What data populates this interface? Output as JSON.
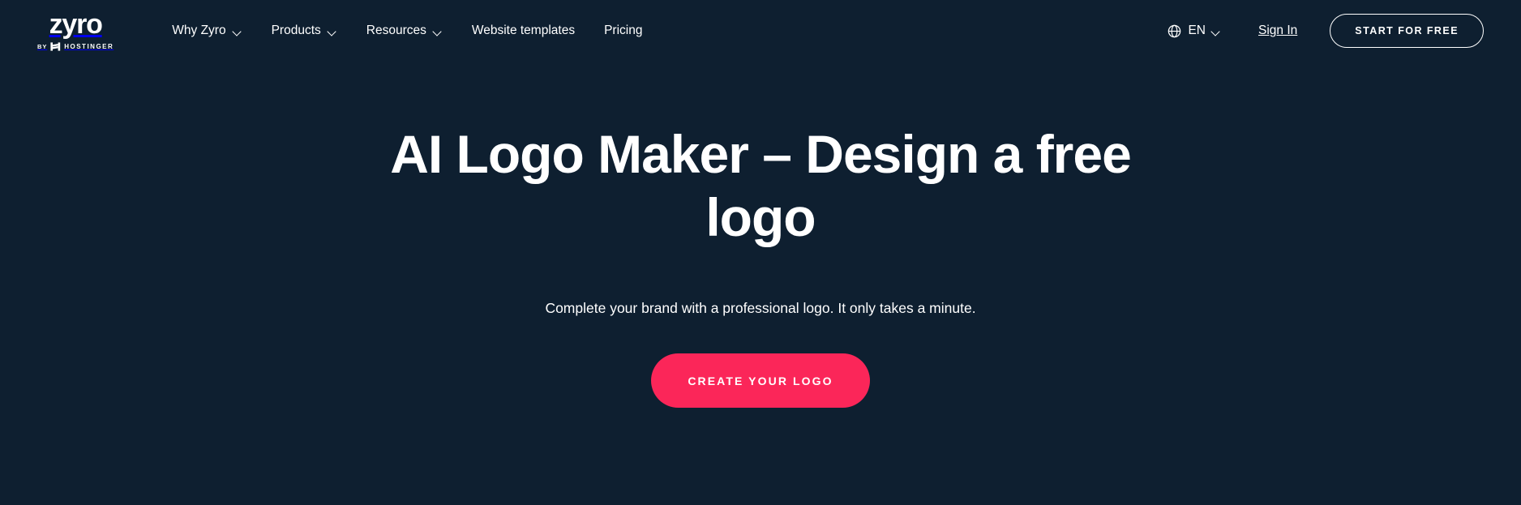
{
  "theme": {
    "background": "#0E1F30",
    "text": "#FFFFFF",
    "accent": "#FB2659"
  },
  "header": {
    "logo": {
      "wordmark": "zyro",
      "by_label": "BY",
      "parent_brand": "HOSTINGER",
      "mark_icon": "hostinger-h-icon"
    },
    "nav": [
      {
        "label": "Why Zyro",
        "has_dropdown": true
      },
      {
        "label": "Products",
        "has_dropdown": true
      },
      {
        "label": "Resources",
        "has_dropdown": true
      },
      {
        "label": "Website templates",
        "has_dropdown": false
      },
      {
        "label": "Pricing",
        "has_dropdown": false
      }
    ],
    "language": {
      "icon": "globe-icon",
      "value": "EN",
      "has_dropdown": true
    },
    "sign_in_label": "Sign In",
    "start_free_label": "START FOR FREE"
  },
  "hero": {
    "title": "AI Logo Maker – Design a free logo",
    "subtitle": "Complete your brand with a professional logo. It only takes a minute.",
    "cta_label": "CREATE YOUR LOGO"
  }
}
